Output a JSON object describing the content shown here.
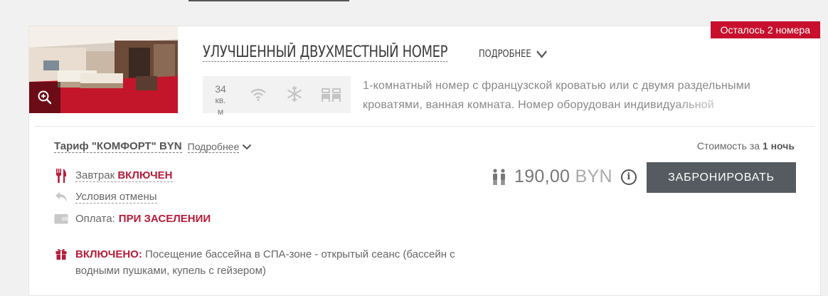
{
  "badge": {
    "rooms_left": "Осталось 2 номера"
  },
  "room": {
    "title": "УЛУЧШЕННЫЙ ДВУХМЕСТНЫЙ НОМЕР",
    "more_label": "ПОДРОБНЕЕ",
    "area_value": "34",
    "area_unit": "кв. м",
    "amenity_icons": [
      "wifi-icon",
      "air-conditioning-icon",
      "twin-beds-icon"
    ],
    "description": "1-комнатный номер с французской кроватью или с двумя раздельными кроватями, ванная комната. Номер оборудован индивидуальной"
  },
  "tariff": {
    "name": "Тариф \"КОМФОРТ\" BYN",
    "more_label": "Подробнее",
    "cost_label_prefix": "Стоимость за",
    "cost_label_period": "1 ночь",
    "breakfast_label": "Завтрак",
    "breakfast_value": "ВКЛЮЧЕН",
    "cancel_label": "Условия отмены",
    "payment_label": "Оплата:",
    "payment_value": "ПРИ ЗАСЕЛЕНИИ",
    "price_amount": "190,00",
    "price_currency": "BYN",
    "book_label": "ЗАБРОНИРОВАТЬ",
    "included_label": "ВКЛЮЧЕНО:",
    "included_text": "Посещение бассейна в СПА-зоне - открытый сеанс (бассейн с водными пушками, купель с гейзером)"
  },
  "colors": {
    "accent_red": "#c8102e",
    "button_gray": "#555b60"
  }
}
